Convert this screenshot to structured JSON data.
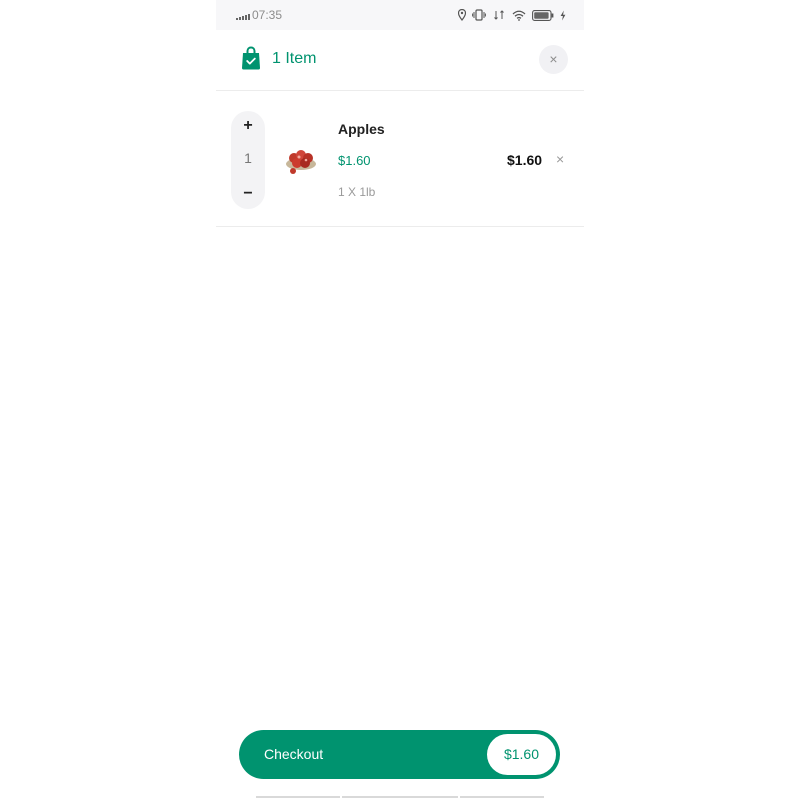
{
  "status_bar": {
    "time": "07:35",
    "battery": "87",
    "icons": [
      "signal-icon",
      "location-icon",
      "vibrate-icon",
      "data-icon",
      "wifi-icon",
      "battery-icon",
      "charging-icon"
    ]
  },
  "header": {
    "item_count": "1 Item",
    "icon": "shopping-bag-icon",
    "close_label": "×"
  },
  "cart": {
    "items": [
      {
        "name": "Apples",
        "price": "$1.60",
        "unit": "1 X 1lb",
        "quantity": "1",
        "total": "$1.60",
        "increase_label": "+",
        "decrease_label": "−",
        "remove_label": "×"
      }
    ]
  },
  "checkout": {
    "label": "Checkout",
    "total": "$1.60"
  },
  "colors": {
    "accent": "#00936f",
    "background": "#ffffff",
    "status_bar_bg": "#f7f7f9",
    "stepper_bg": "#f3f3f5"
  }
}
